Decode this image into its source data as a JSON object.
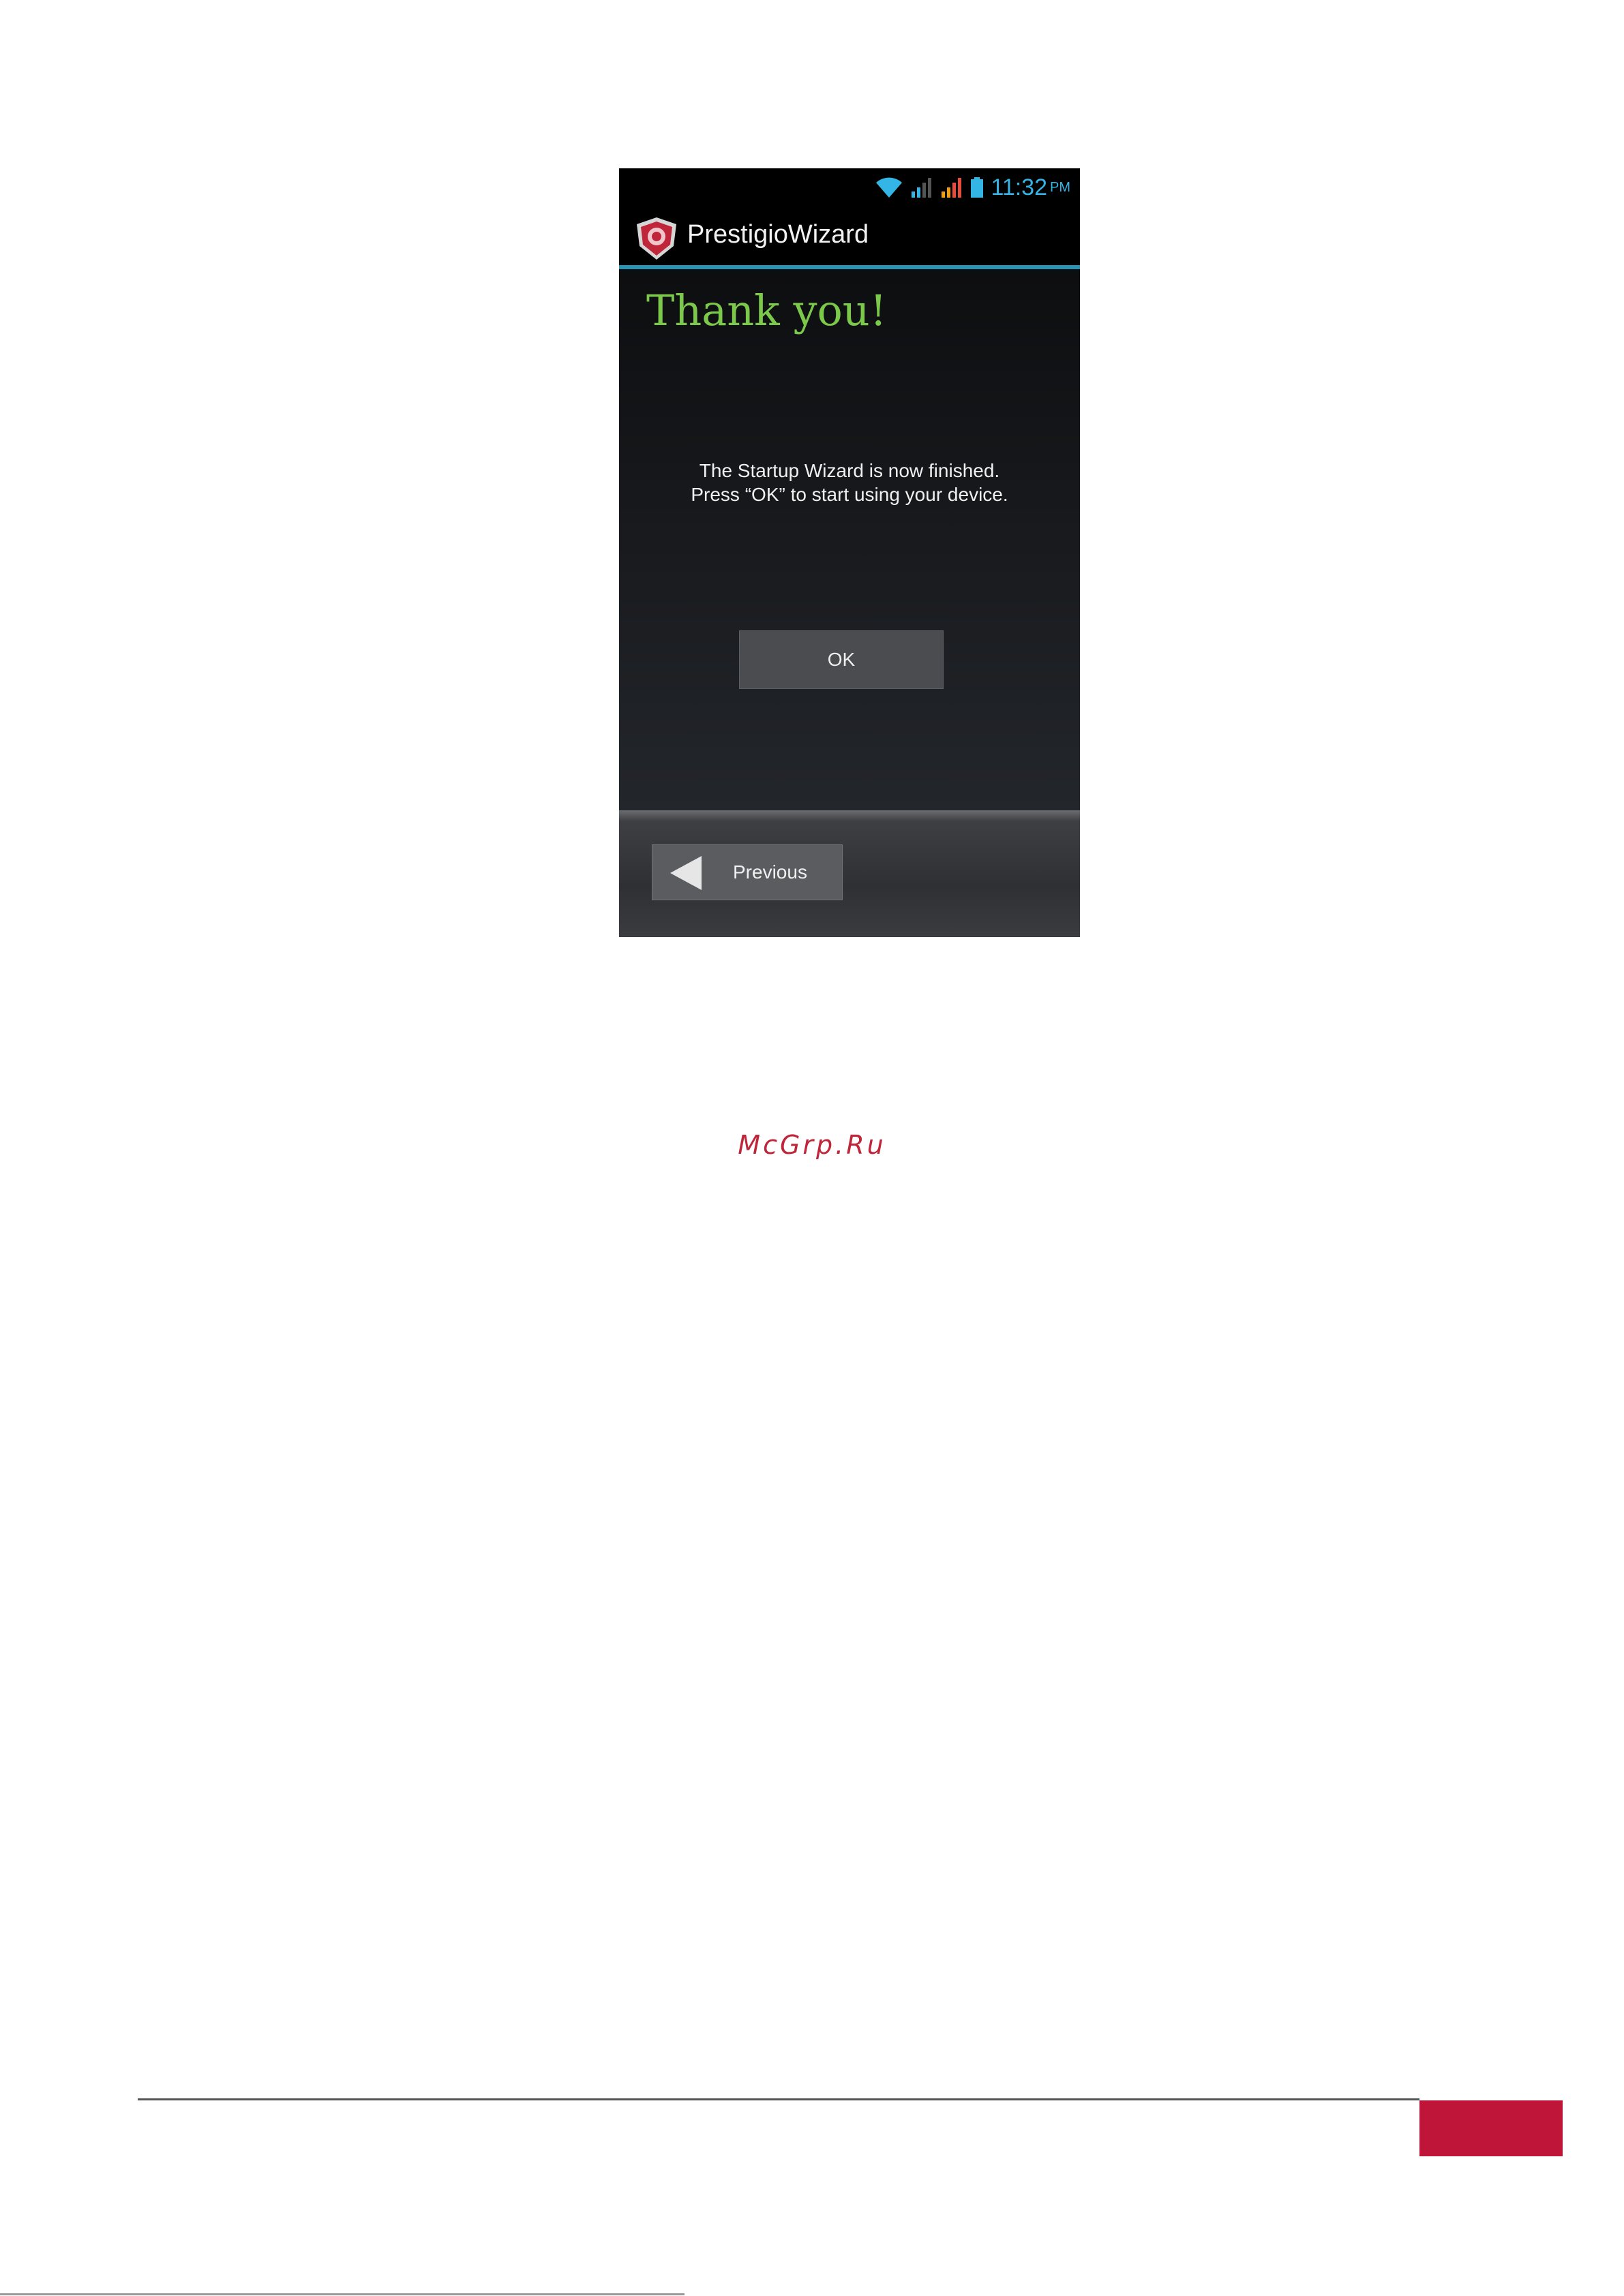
{
  "status_bar": {
    "time": "11:32",
    "ampm": "PM",
    "icons": [
      "wifi-icon",
      "signal-icon",
      "signal-icon",
      "battery-icon"
    ],
    "accent": "#33b5e5"
  },
  "action_bar": {
    "title": "PrestigioWizard",
    "divider_color": "#2a93b3"
  },
  "content": {
    "heading": "Thank you!",
    "heading_color": "#7cc84a",
    "message_line1": "The Startup Wizard is now finished.",
    "message_line2": "Press “OK” to start using your device.",
    "ok_label": "OK"
  },
  "footer_bar": {
    "previous_label": "Previous"
  },
  "page": {
    "watermark": "McGrp.Ru",
    "accent": "#be1538"
  }
}
